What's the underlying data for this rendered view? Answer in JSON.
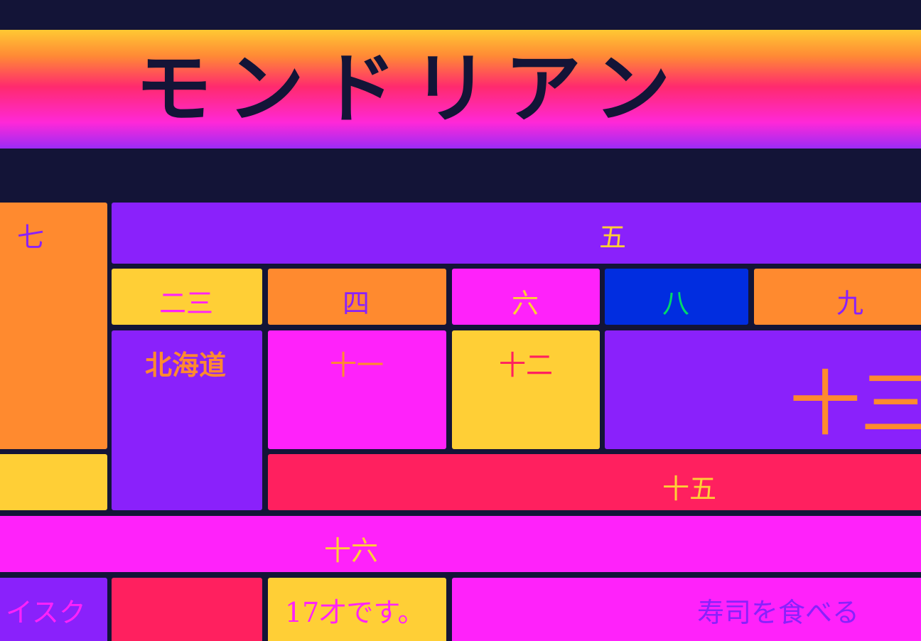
{
  "banner": {
    "title": "モンドリアン"
  },
  "cells": {
    "seven": "七",
    "five": "五",
    "twothree": "二三",
    "four": "四",
    "six": "六",
    "eight": "八",
    "nine": "九",
    "hokkaido": "北海道",
    "eleven": "十一",
    "twelve": "十二",
    "thirteen": "十三",
    "fifteen": "十五",
    "sixteen": "十六",
    "isuku": "イスク",
    "seventeen": "17才です。",
    "sushi": "寿司を食べる"
  },
  "colors": {
    "background": "#131437",
    "purple": "#8a21fb",
    "orange": "#ff8a2f",
    "yellow": "#ffcf36",
    "magenta": "#ff22fa",
    "blue": "#012de0",
    "red": "#ff205f",
    "green": "#00d96a"
  }
}
